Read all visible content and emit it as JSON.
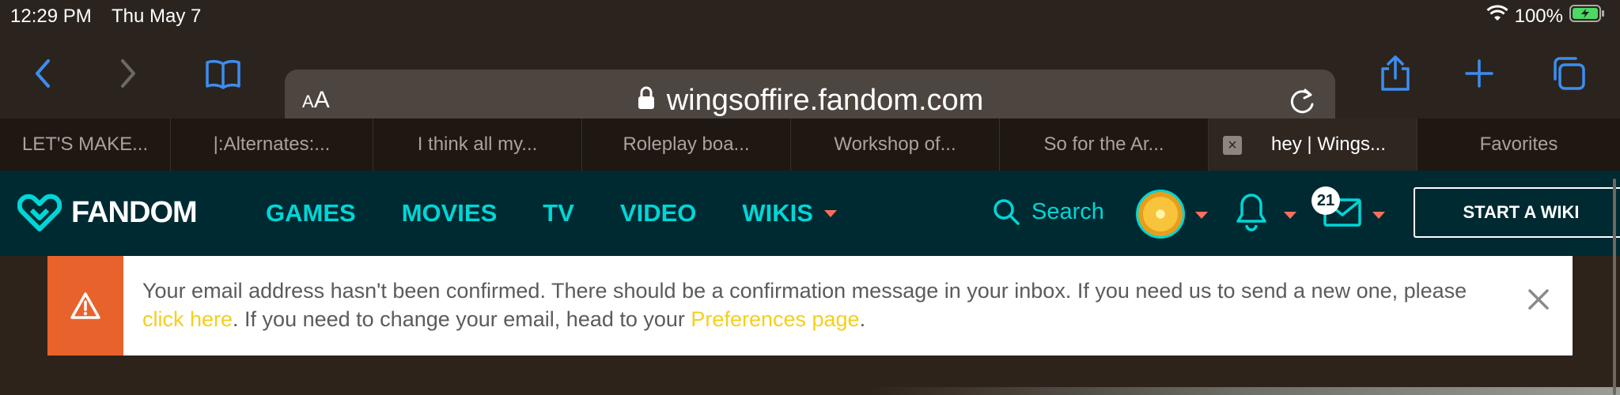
{
  "status_bar": {
    "time": "12:29 PM",
    "date": "Thu May 7",
    "battery": "100%"
  },
  "browser": {
    "text_size_label": "AA",
    "url": "wingsoffire.fandom.com",
    "tabs": [
      {
        "label": "LET'S MAKE..."
      },
      {
        "label": "|:Alternates:..."
      },
      {
        "label": "I think all my..."
      },
      {
        "label": "Roleplay boa..."
      },
      {
        "label": "Workshop of..."
      },
      {
        "label": "So for the Ar..."
      },
      {
        "label": "hey | Wings...",
        "active": true
      },
      {
        "label": "Favorites"
      }
    ]
  },
  "fandom": {
    "logo_text": "FANDOM",
    "nav": [
      {
        "label": "GAMES"
      },
      {
        "label": "MOVIES"
      },
      {
        "label": "TV"
      },
      {
        "label": "VIDEO"
      },
      {
        "label": "WIKIS"
      }
    ],
    "search_label": "Search",
    "mail_badge": "21",
    "start_wiki": "START A WIKI",
    "colors": {
      "brand": "#002a32",
      "accent": "#00d6d6",
      "caret": "#fd6f5d"
    }
  },
  "notice": {
    "text_1": "Your email address hasn't been confirmed. There should be a confirmation message in your inbox. If you need us to send a new one, please ",
    "link_1": "click here",
    "text_2": ". If you need to change your email, head to your ",
    "link_2": "Preferences page",
    "text_3": ".",
    "warning_color": "#e8622c"
  }
}
